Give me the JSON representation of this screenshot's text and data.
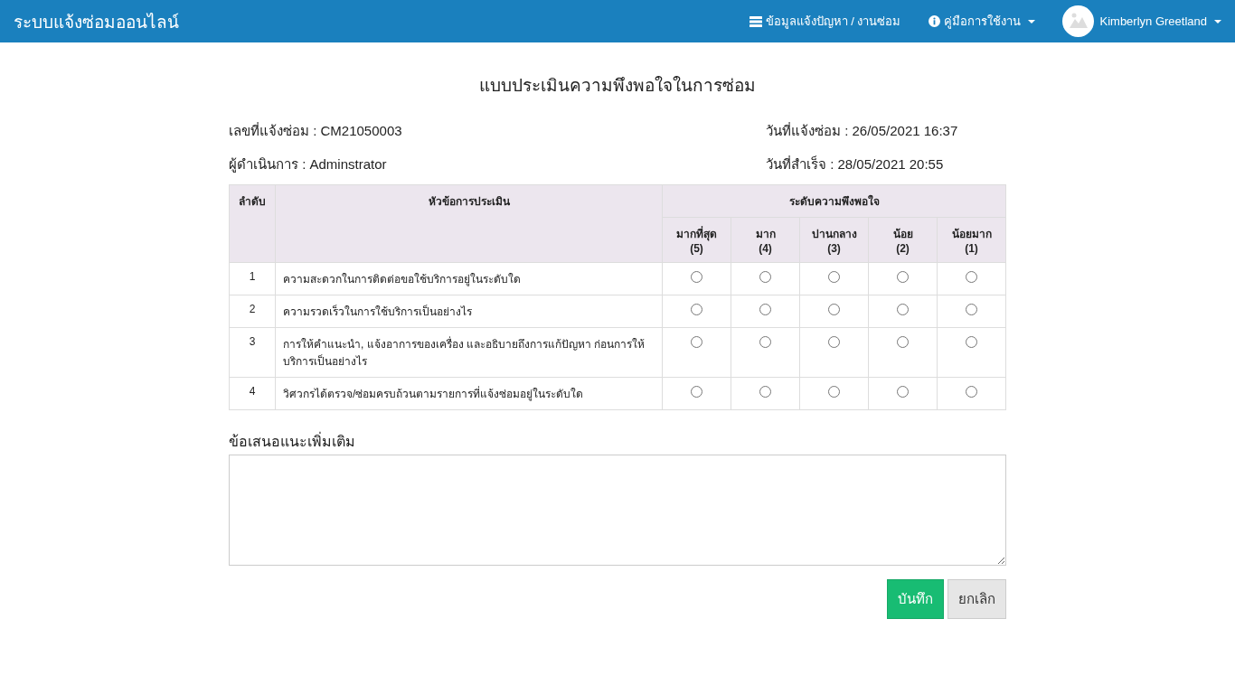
{
  "navbar": {
    "brand": "ระบบแจ้งซ่อมออนไลน์",
    "links": [
      {
        "kind": "list",
        "label": "ข้อมูลแจ้งปัญหา / งานซ่อม",
        "dropdown": false
      },
      {
        "kind": "info",
        "label": "คู่มือการใช้งาน",
        "dropdown": true
      }
    ],
    "user": {
      "name": "Kimberlyn Greetland",
      "dropdown": true
    }
  },
  "title": "แบบประเมินความพึงพอใจในการซ่อม",
  "info": [
    {
      "label": "เลขที่แจ้งซ่อม : CM21050003"
    },
    {
      "label": "วันที่แจ้งซ่อม : 26/05/2021 16:37"
    },
    {
      "label": "ผู้ดำเนินการ : Adminstrator"
    },
    {
      "label": "วันที่สำเร็จ : 28/05/2021 20:55"
    }
  ],
  "table": {
    "columns": {
      "number": "ลำดับ",
      "topic": "หัวข้อการประเมิน",
      "level_group": "ระดับความพึงพอใจ",
      "levels": [
        {
          "label": "มากที่สุด",
          "score": "(5)"
        },
        {
          "label": "มาก",
          "score": "(4)"
        },
        {
          "label": "ปานกลาง",
          "score": "(3)"
        },
        {
          "label": "น้อย",
          "score": "(2)"
        },
        {
          "label": "น้อยมาก",
          "score": "(1)"
        }
      ]
    },
    "rows": [
      {
        "number": "1",
        "topic": "ความสะดวกในการติดต่อขอใช้บริการอยู่ในระดับใด",
        "choices": [
          {
            "selected": false
          },
          {
            "selected": false
          },
          {
            "selected": false
          },
          {
            "selected": false
          },
          {
            "selected": false
          }
        ]
      },
      {
        "number": "2",
        "topic": "ความรวดเร็วในการใช้บริการเป็นอย่างไร",
        "choices": [
          {
            "selected": false
          },
          {
            "selected": false
          },
          {
            "selected": false
          },
          {
            "selected": false
          },
          {
            "selected": false
          }
        ]
      },
      {
        "number": "3",
        "topic": "การให้คำแนะนำ, แจ้งอาการของเครื่อง และอธิบายถึงการแก้ปัญหา ก่อนการให้บริการเป็นอย่างไร",
        "choices": [
          {
            "selected": false
          },
          {
            "selected": false
          },
          {
            "selected": false
          },
          {
            "selected": false
          },
          {
            "selected": false
          }
        ]
      },
      {
        "number": "4",
        "topic": "วิศวกรได้ตรวจ/ซ่อมครบถ้วนตามรายการที่แจ้งซ่อมอยู่ในระดับใด",
        "choices": [
          {
            "selected": false
          },
          {
            "selected": false
          },
          {
            "selected": false
          },
          {
            "selected": false
          },
          {
            "selected": false
          }
        ]
      }
    ]
  },
  "suggestion": {
    "label": "ข้อเสนอแนะเพิ่มเติม"
  },
  "buttons": [
    {
      "kind": "primary",
      "label": "บันทึก"
    },
    {
      "kind": "default",
      "label": "ยกเลิก"
    }
  ]
}
